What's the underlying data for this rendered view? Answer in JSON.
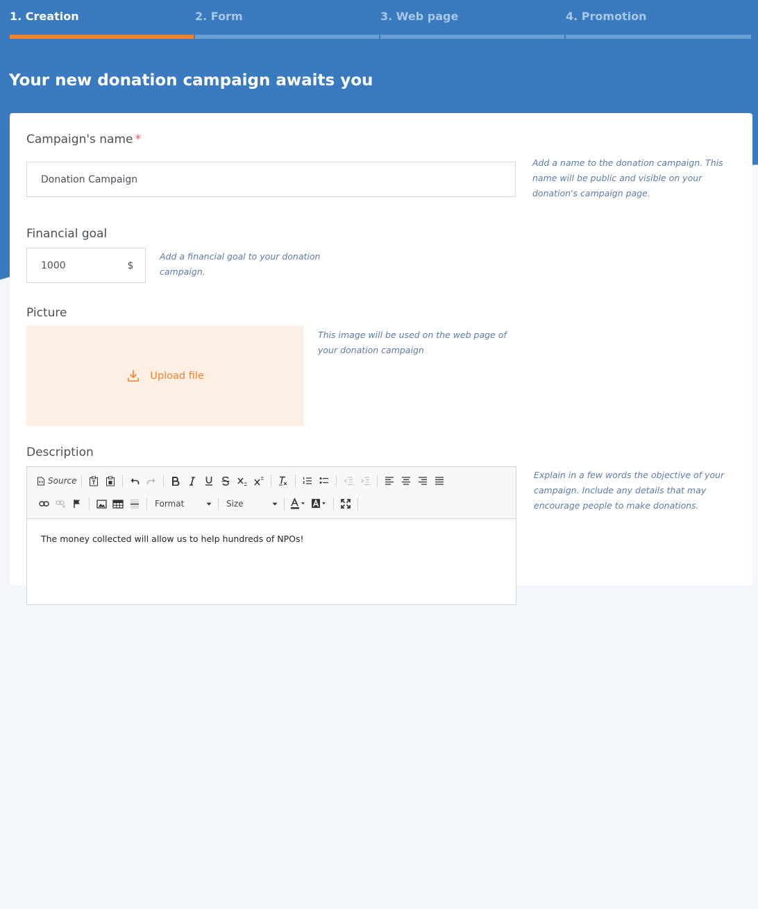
{
  "steps": [
    {
      "label": "1. Creation",
      "active": true
    },
    {
      "label": "2. Form",
      "active": false
    },
    {
      "label": "3. Web page",
      "active": false
    },
    {
      "label": "4. Promotion",
      "active": false
    }
  ],
  "hero": {
    "title": "Your new donation campaign awaits you"
  },
  "form": {
    "name": {
      "label": "Campaign's name",
      "required_mark": "*",
      "value": "Donation Campaign",
      "hint": "Add a name to the donation campaign. This name will be public and visible on your donation's campaign page."
    },
    "goal": {
      "label": "Financial goal",
      "value": "1000",
      "currency": "$",
      "hint": "Add a financial goal to your donation campaign."
    },
    "picture": {
      "label": "Picture",
      "upload_label": "Upload file",
      "hint": "This image will be used on the web page of your donation campaign"
    },
    "description": {
      "label": "Description",
      "hint": "Explain in a few words the objective of your campaign. Include any details that may encourage people to make donations.",
      "content": "The money collected will allow us to help hundreds of NPOs!",
      "toolbar": {
        "source_label": "Source",
        "format_label": "Format",
        "size_label": "Size"
      }
    }
  },
  "colors": {
    "primary_blue": "#3a7bbf",
    "accent_orange": "#f2832c",
    "upload_bg": "#fdefe3",
    "hint_blue": "#5a7ca8"
  }
}
